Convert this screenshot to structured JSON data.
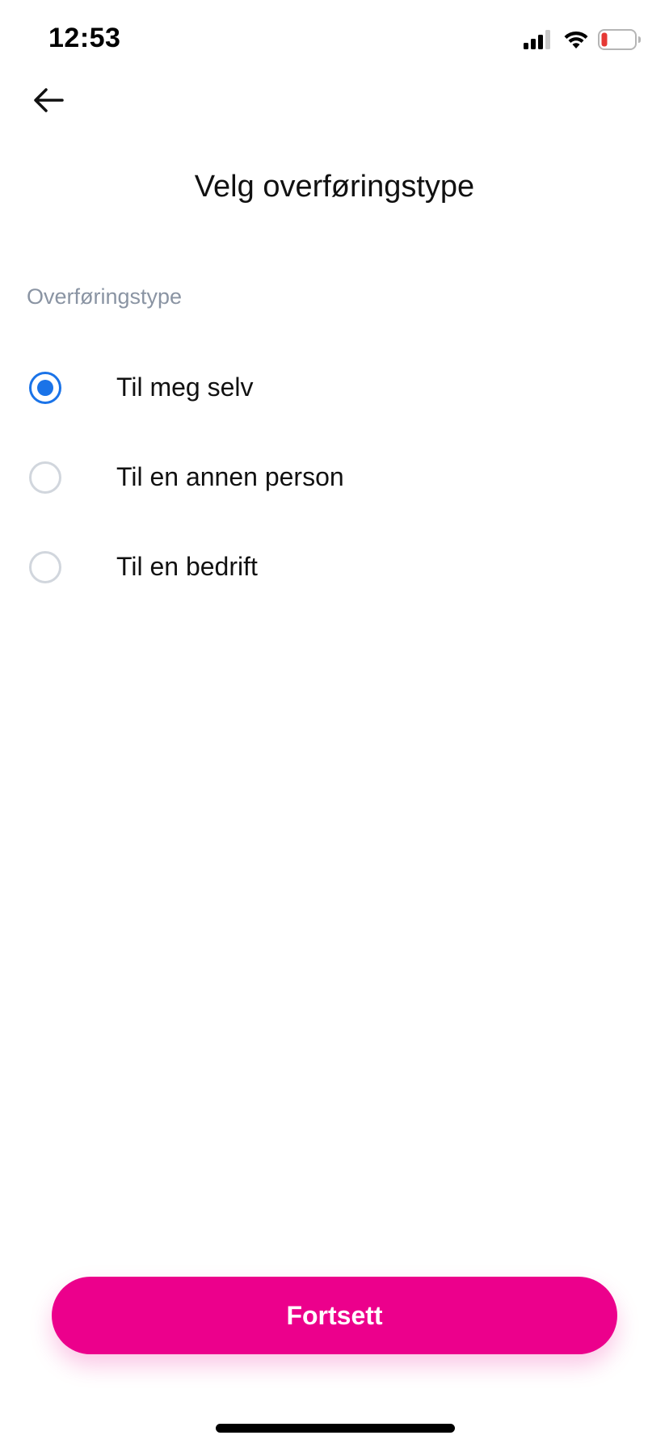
{
  "status_bar": {
    "time": "12:53",
    "icons": [
      "cellular-signal-icon",
      "wifi-icon",
      "battery-low-icon"
    ],
    "battery_color": "#e53935"
  },
  "header": {
    "back_icon": "arrow-left-icon",
    "title": "Velg overføringstype"
  },
  "section": {
    "label": "Overføringstype"
  },
  "options": [
    {
      "label": "Til meg selv",
      "selected": true
    },
    {
      "label": "Til en annen person",
      "selected": false
    },
    {
      "label": "Til en bedrift",
      "selected": false
    }
  ],
  "footer": {
    "continue_label": "Fortsett"
  },
  "colors": {
    "accent": "#ec008c",
    "radio_selected": "#1a73e8",
    "radio_unselected": "#d1d6dd",
    "section_label": "#8a94a3"
  }
}
